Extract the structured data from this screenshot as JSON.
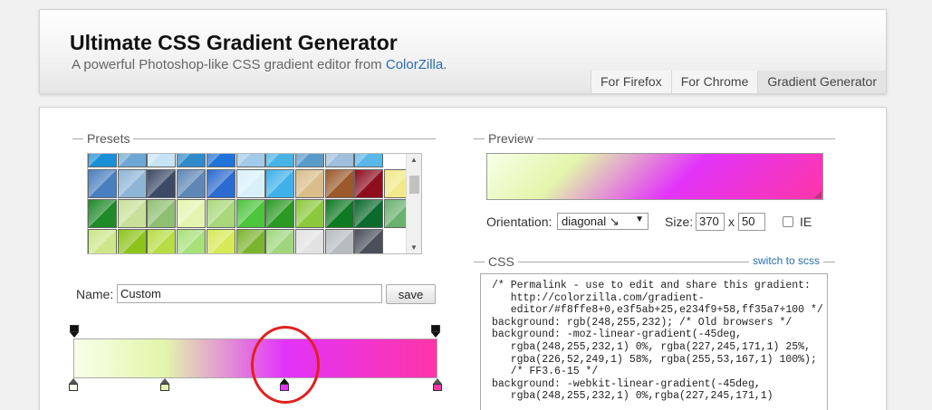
{
  "header": {
    "title": "Ultimate CSS Gradient Generator",
    "subtitle_prefix": "A powerful Photoshop-like CSS gradient editor from ",
    "subtitle_link": "ColorZilla",
    "subtitle_suffix": ".",
    "tabs": [
      {
        "label": "For Firefox",
        "active": false
      },
      {
        "label": "For Chrome",
        "active": false
      },
      {
        "label": "Gradient Generator",
        "active": true
      }
    ]
  },
  "presets": {
    "legend": "Presets",
    "rows": [
      [
        "#1a8fd6",
        "#6fa7d4",
        "#c7e4f5",
        "#2f8ac9",
        "#1f73d9",
        "#a3cbe9",
        "#4ab3e6",
        "#5a9cc9",
        "#9fbfdd",
        "#59b8e8"
      ],
      [
        "#4a7fbf",
        "#8fb5d6",
        "#3c4a66",
        "#5e87b5",
        "#2b6bd1",
        "#d9f0fa",
        "#3fb0ea",
        "#d9bd8a",
        "#9c5a2a",
        "#8e0e1e",
        "#f2e98a"
      ],
      [
        "#1e8a28",
        "#c8e09a",
        "#8fbf72",
        "#e4f5b0",
        "#a8d87a",
        "#4cc43c",
        "#2a9a22",
        "#8cc83c",
        "#0e7a22",
        "#0b6b2e",
        "#6ab06e"
      ],
      [
        "#cde68a",
        "#8cc41c",
        "#b6dd44",
        "#a8e07a",
        "#d6ea56",
        "#7cb42e",
        "#9fd67c",
        "#e2e2e2",
        "#b8bcc0",
        "#4a4f5a"
      ]
    ]
  },
  "name": {
    "label": "Name:",
    "value": "Custom",
    "save_label": "save"
  },
  "editor": {
    "colors": [
      "#f8ffe8",
      "#e3f5ab",
      "#e234f9",
      "#ff35a7"
    ],
    "stops": [
      0,
      25,
      58,
      100
    ],
    "opacity_stops": [
      0,
      100
    ]
  },
  "preview": {
    "legend": "Preview",
    "orientation_label": "Orientation:",
    "orientation_value": "diagonal ↘",
    "size_label": "Size:",
    "width": "370",
    "size_sep": "x",
    "height": "50",
    "ie_label": "IE"
  },
  "css": {
    "legend": "CSS",
    "switch_label": "switch to scss",
    "lines": [
      "/* Permalink - use to edit and share this gradient:",
      "   http://colorzilla.com/gradient-",
      "   editor/#f8ffe8+0,e3f5ab+25,e234f9+58,ff35a7+100 */",
      "background: rgb(248,255,232); /* Old browsers */",
      "background: -moz-linear-gradient(-45deg,",
      "   rgba(248,255,232,1) 0%, rgba(227,245,171,1) 25%,",
      "   rgba(226,52,249,1) 58%, rgba(255,53,167,1) 100%);",
      "   /* FF3.6-15 */",
      "background: -webkit-linear-gradient(-45deg,",
      "   rgba(248,255,232,1) 0%,rgba(227,245,171,1)"
    ]
  }
}
